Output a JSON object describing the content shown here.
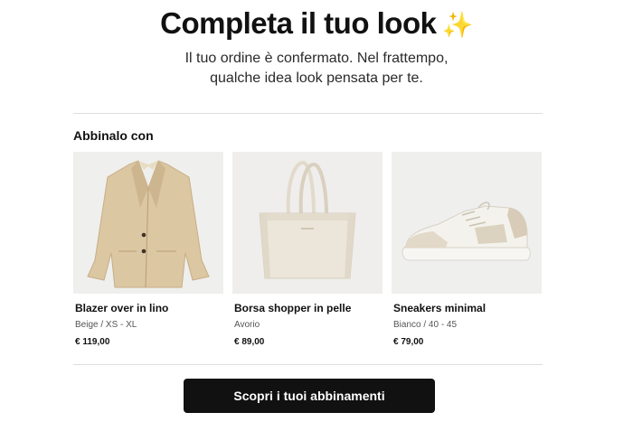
{
  "header": {
    "title": "Completa il tuo look",
    "sparkle_icon": "✨",
    "subtitle_line1": "Il tuo ordine è confermato. Nel frattempo,",
    "subtitle_line2": "qualche idea look pensata per te."
  },
  "section": {
    "title": "Abbinalo con"
  },
  "products": [
    {
      "name": "Blazer over in lino",
      "variant": "Beige / XS - XL",
      "price": "€ 119,00",
      "icon": "blazer-icon"
    },
    {
      "name": "Borsa shopper in pelle",
      "variant": "Avorio",
      "price": "€ 89,00",
      "icon": "tote-bag-icon"
    },
    {
      "name": "Sneakers minimal",
      "variant": "Bianco / 40 - 45",
      "price": "€ 79,00",
      "icon": "sneaker-icon"
    }
  ],
  "cta": {
    "label": "Scopri i tuoi abbinamenti"
  },
  "colors": {
    "background": "#ffffff",
    "text": "#111111",
    "button": "#111111",
    "button_text": "#ffffff",
    "divider": "#dedede",
    "image_bg": "#eeeeed",
    "blazer": "#dcc7a3",
    "bag": "#ece6da",
    "sneaker_accent": "#d8cbb7"
  }
}
